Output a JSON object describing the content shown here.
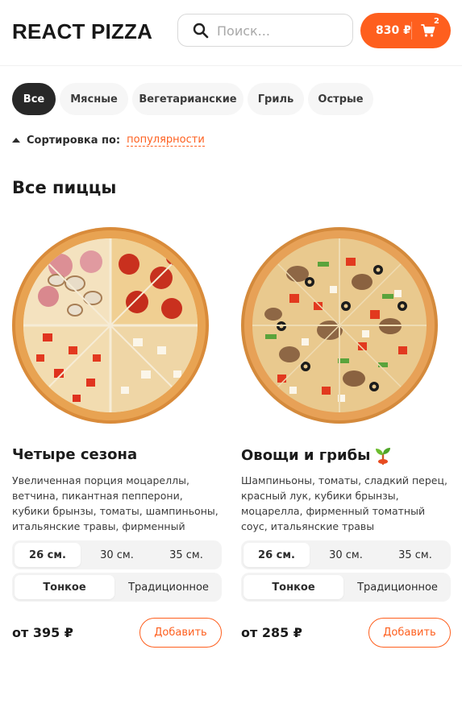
{
  "header": {
    "logo": "REACT PIZZA",
    "search_placeholder": "Поиск...",
    "cart_price": "830 ₽",
    "cart_count": "2"
  },
  "categories": [
    "Все",
    "Мясные",
    "Вегетарианские",
    "Гриль",
    "Острые"
  ],
  "active_category": "Все",
  "sort": {
    "label": "Сортировка по:",
    "value": "популярности"
  },
  "section_title": "Все пиццы",
  "pizzas": [
    {
      "name": "Четыре сезона",
      "description": "Увеличенная порция моцареллы, ветчина, пикантная пепперони, кубики брынзы, томаты, шампиньоны, итальянские травы, фирменный",
      "sizes": [
        "26 см.",
        "30 см.",
        "35 см."
      ],
      "selected_size": "26 см.",
      "types": [
        "Тонкое",
        "Традиционное"
      ],
      "selected_type": "Тонкое",
      "price": "от 395 ₽",
      "add_label": "Добавить",
      "vegetarian": false
    },
    {
      "name": "Овощи и грибы",
      "description": "Шампиньоны, томаты, сладкий перец, красный лук, кубики брынзы, моцарелла, фирменный томатный соус, итальянские травы",
      "sizes": [
        "26 см.",
        "30 см.",
        "35 см."
      ],
      "selected_size": "26 см.",
      "types": [
        "Тонкое",
        "Традиционное"
      ],
      "selected_type": "Тонкое",
      "price": "от 285 ₽",
      "add_label": "Добавить",
      "vegetarian": true
    }
  ],
  "colors": {
    "accent": "#fe5f1e",
    "dark": "#282828",
    "chip_bg": "#f6f6f6"
  }
}
